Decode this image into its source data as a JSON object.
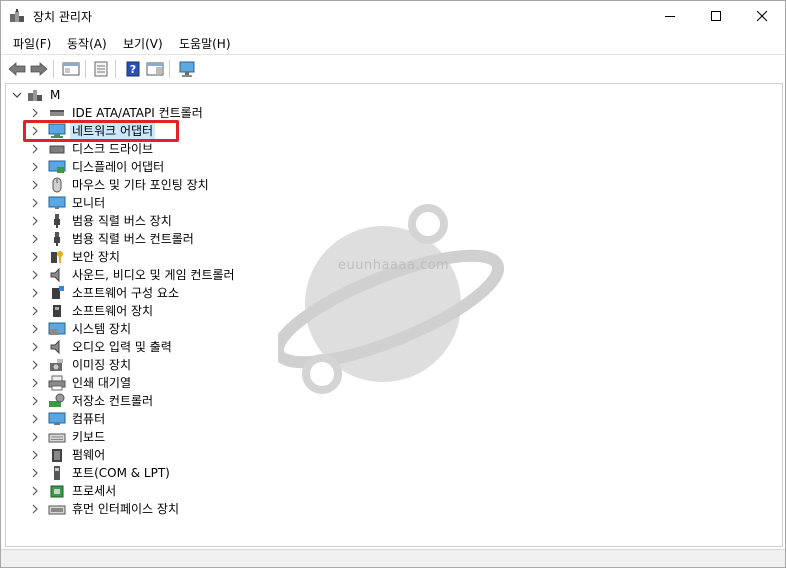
{
  "window": {
    "title": "장치 관리자"
  },
  "menu": [
    {
      "label": "파일(F)"
    },
    {
      "label": "동작(A)"
    },
    {
      "label": "보기(V)"
    },
    {
      "label": "도움말(H)"
    }
  ],
  "tree": {
    "root_label": "M",
    "items": [
      {
        "label": "IDE ATA/ATAPI 컨트롤러",
        "icon": "ide-controller-icon"
      },
      {
        "label": "네트워크 어댑터",
        "icon": "network-adapter-icon",
        "selected": true
      },
      {
        "label": "디스크 드라이브",
        "icon": "disk-drive-icon"
      },
      {
        "label": "디스플레이 어댑터",
        "icon": "display-adapter-icon"
      },
      {
        "label": "마우스 및 기타 포인팅 장치",
        "icon": "mouse-icon"
      },
      {
        "label": "모니터",
        "icon": "monitor-icon"
      },
      {
        "label": "범용 직렬 버스 장치",
        "icon": "usb-icon"
      },
      {
        "label": "범용 직렬 버스 컨트롤러",
        "icon": "usb-controller-icon"
      },
      {
        "label": "보안 장치",
        "icon": "security-key-icon"
      },
      {
        "label": "사운드, 비디오 및 게임 컨트롤러",
        "icon": "speaker-icon"
      },
      {
        "label": "소프트웨어 구성 요소",
        "icon": "software-component-icon"
      },
      {
        "label": "소프트웨어 장치",
        "icon": "software-device-icon"
      },
      {
        "label": "시스템 장치",
        "icon": "system-device-icon"
      },
      {
        "label": "오디오 입력 및 출력",
        "icon": "audio-icon"
      },
      {
        "label": "이미징 장치",
        "icon": "camera-icon"
      },
      {
        "label": "인쇄 대기열",
        "icon": "printer-icon"
      },
      {
        "label": "저장소 컨트롤러",
        "icon": "storage-controller-icon"
      },
      {
        "label": "컴퓨터",
        "icon": "computer-icon"
      },
      {
        "label": "키보드",
        "icon": "keyboard-icon"
      },
      {
        "label": "펌웨어",
        "icon": "firmware-icon"
      },
      {
        "label": "포트(COM & LPT)",
        "icon": "port-icon"
      },
      {
        "label": "프로세서",
        "icon": "processor-icon"
      },
      {
        "label": "휴먼 인터페이스 장치",
        "icon": "hid-icon"
      }
    ]
  },
  "watermark": {
    "text": "euunhaaaa.com"
  },
  "colors": {
    "highlight": "#e0202a",
    "selection": "#cce8ff",
    "watermark": "#d4d4d4"
  }
}
